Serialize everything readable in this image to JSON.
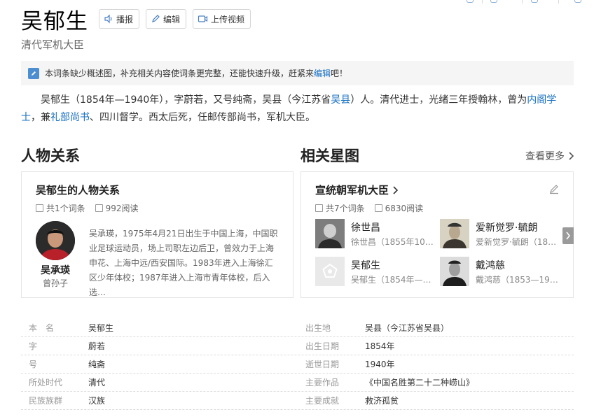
{
  "header": {
    "title": "吴郁生",
    "buttons": {
      "play": "播报",
      "edit": "编辑",
      "upload_video": "上传视频"
    },
    "subtitle": "清代军机大臣"
  },
  "notice": {
    "text_before": "本词条缺少概述图，补充相关内容使词条更完整，还能快速升级，赶紧来",
    "link": "编辑",
    "text_after": "吧！"
  },
  "summary": {
    "p1": "吴郁生（1854年—1940年），字蔚若，又号纯斋，吴县（今江苏省",
    "link1": "吴县",
    "p2": "）人。清代进士，光绪三年授翰林，曾为",
    "link2": "内阁学士",
    "p3": "，兼",
    "link3": "礼部尚书",
    "p4": "、四川督学。西太后死，任邮传部尚书，军机大臣。"
  },
  "relations": {
    "section_title": "人物关系",
    "card_title": "吴郁生的人物关系",
    "entries": "共1个词条",
    "views": "992阅读",
    "person": {
      "name": "吴承瑛",
      "role": "曾孙子",
      "desc": "吴承瑛，1975年4月21日出生于中国上海，中国职业足球运动员，场上司职左边后卫，曾效力于上海申花、上海中远/西安国际。1983年进入上海徐汇区少年体校；1987年进入上海市青年体校，后入选…"
    }
  },
  "star_map": {
    "section_title": "相关星图",
    "more": "查看更多",
    "card_title": "宣统朝军机大臣",
    "entries": "共7个词条",
    "views": "6830阅读",
    "people": [
      {
        "name": "徐世昌",
        "desc": "徐世昌（1855年10…"
      },
      {
        "name": "爱新觉罗·毓朗",
        "desc": "爱新觉罗·毓朗（186…"
      },
      {
        "name": "吴郁生",
        "desc": "吴郁生（1854年—1…"
      },
      {
        "name": "戴鸿慈",
        "desc": "戴鸿慈（1853—191…"
      }
    ]
  },
  "basic_info": {
    "rows": [
      {
        "k1": "本　名",
        "v1": "吴郁生",
        "k2": "出生地",
        "v2": "吴县（今江苏省吴县）"
      },
      {
        "k1": "字",
        "v1": "蔚若",
        "k2": "出生日期",
        "v2": "1854年"
      },
      {
        "k1": "号",
        "v1": "纯斋",
        "k2": "逝世日期",
        "v2": "1940年"
      },
      {
        "k1": "所处时代",
        "v1": "清代",
        "k2": "主要作品",
        "v2": "《中国名胜第二十二种崂山》"
      },
      {
        "k1": "民族族群",
        "v1": "汉族",
        "k2": "主要成就",
        "v2": "救济孤贫"
      }
    ]
  },
  "colors": {
    "link": "#136ec2",
    "notice_bg": "#f5f5f5",
    "notice_icon": "#4c8ecf"
  }
}
